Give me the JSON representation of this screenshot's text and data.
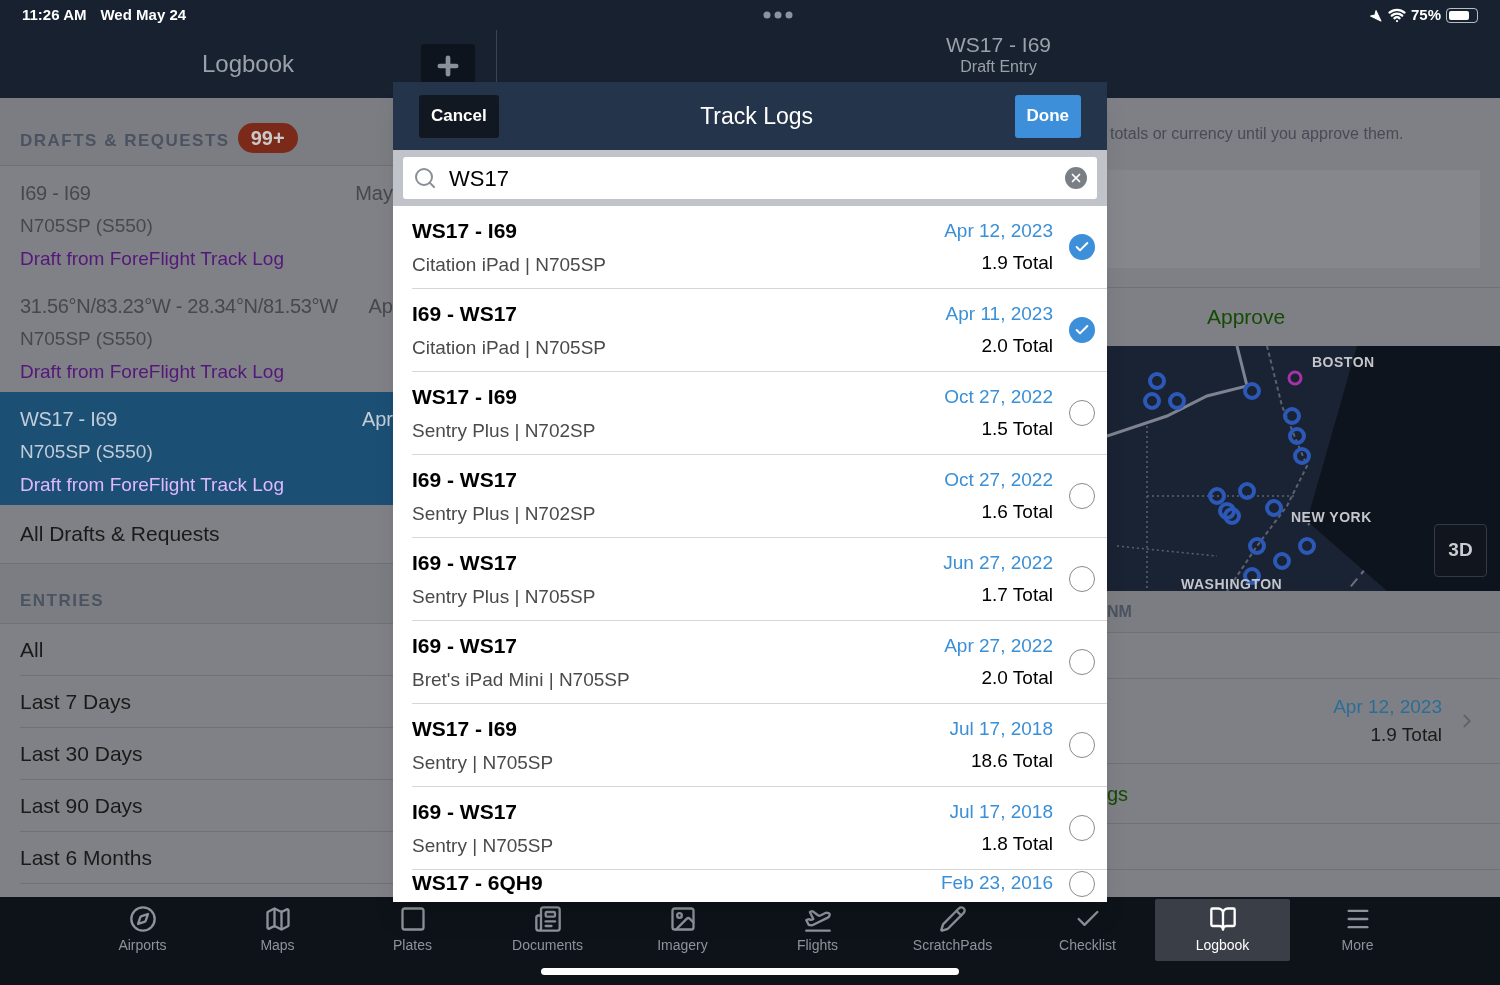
{
  "status_bar": {
    "time": "11:26 AM",
    "date": "Wed May 24",
    "battery": "75%"
  },
  "sidebar": {
    "title": "Logbook",
    "drafts_header": "DRAFTS & REQUESTS",
    "drafts_badge": "99+",
    "drafts": [
      {
        "route": "I69 - I69",
        "aircraft": "N705SP (S550)",
        "source": "Draft from ForeFlight Track Log",
        "date": "May",
        "selected": false
      },
      {
        "route": "31.56°N/83.23°W - 28.34°N/81.53°W",
        "aircraft": "N705SP (S550)",
        "source": "Draft from ForeFlight Track Log",
        "date": "Ap",
        "selected": false
      },
      {
        "route": "WS17 - I69",
        "aircraft": "N705SP (S550)",
        "source": "Draft from ForeFlight Track Log",
        "date": "Apr",
        "selected": true
      }
    ],
    "all_drafts": "All Drafts & Requests",
    "entries_header": "ENTRIES",
    "entries": [
      "All",
      "Last 7 Days",
      "Last 30 Days",
      "Last 90 Days",
      "Last 6 Months"
    ]
  },
  "detail": {
    "title": "WS17 - I69",
    "subtitle": "Draft Entry",
    "notice": "totals or currency until you approve them.",
    "approve": "Approve",
    "map_labels": [
      "BOSTON",
      "NEW YORK",
      "WASHINGTON"
    ],
    "map_button": "3D",
    "distance_label": "NM",
    "track": {
      "date": "Apr 12, 2023",
      "total": "1.9 Total"
    },
    "link_fragment": "gs"
  },
  "modal": {
    "cancel": "Cancel",
    "title": "Track Logs",
    "done": "Done",
    "search": {
      "value": "WS17"
    },
    "logs": [
      {
        "route": "WS17 - I69",
        "device": "Citation iPad | N705SP",
        "date": "Apr 12, 2023",
        "total": "1.9 Total",
        "selected": true
      },
      {
        "route": "I69 - WS17",
        "device": "Citation iPad | N705SP",
        "date": "Apr 11, 2023",
        "total": "2.0 Total",
        "selected": true
      },
      {
        "route": "WS17 - I69",
        "device": "Sentry Plus | N702SP",
        "date": "Oct 27, 2022",
        "total": "1.5 Total",
        "selected": false
      },
      {
        "route": "I69 - WS17",
        "device": "Sentry Plus | N702SP",
        "date": "Oct 27, 2022",
        "total": "1.6 Total",
        "selected": false
      },
      {
        "route": "I69 - WS17",
        "device": "Sentry Plus | N705SP",
        "date": "Jun 27, 2022",
        "total": "1.7 Total",
        "selected": false
      },
      {
        "route": "I69 - WS17",
        "device": "Bret's iPad Mini | N705SP",
        "date": "Apr 27, 2022",
        "total": "2.0 Total",
        "selected": false
      },
      {
        "route": "WS17 - I69",
        "device": "Sentry | N705SP",
        "date": "Jul 17, 2018",
        "total": "18.6 Total",
        "selected": false
      },
      {
        "route": "I69 - WS17",
        "device": "Sentry | N705SP",
        "date": "Jul 17, 2018",
        "total": "1.8 Total",
        "selected": false
      },
      {
        "route": "WS17 - 6QH9",
        "date": "Feb 23, 2016",
        "selected": false
      }
    ]
  },
  "tabs": [
    {
      "label": "Airports",
      "selected": false
    },
    {
      "label": "Maps",
      "selected": false
    },
    {
      "label": "Plates",
      "selected": false
    },
    {
      "label": "Documents",
      "selected": false
    },
    {
      "label": "Imagery",
      "selected": false
    },
    {
      "label": "Flights",
      "selected": false
    },
    {
      "label": "ScratchPads",
      "selected": false
    },
    {
      "label": "Checklist",
      "selected": false
    },
    {
      "label": "Logbook",
      "selected": true
    },
    {
      "label": "More",
      "selected": false
    }
  ]
}
